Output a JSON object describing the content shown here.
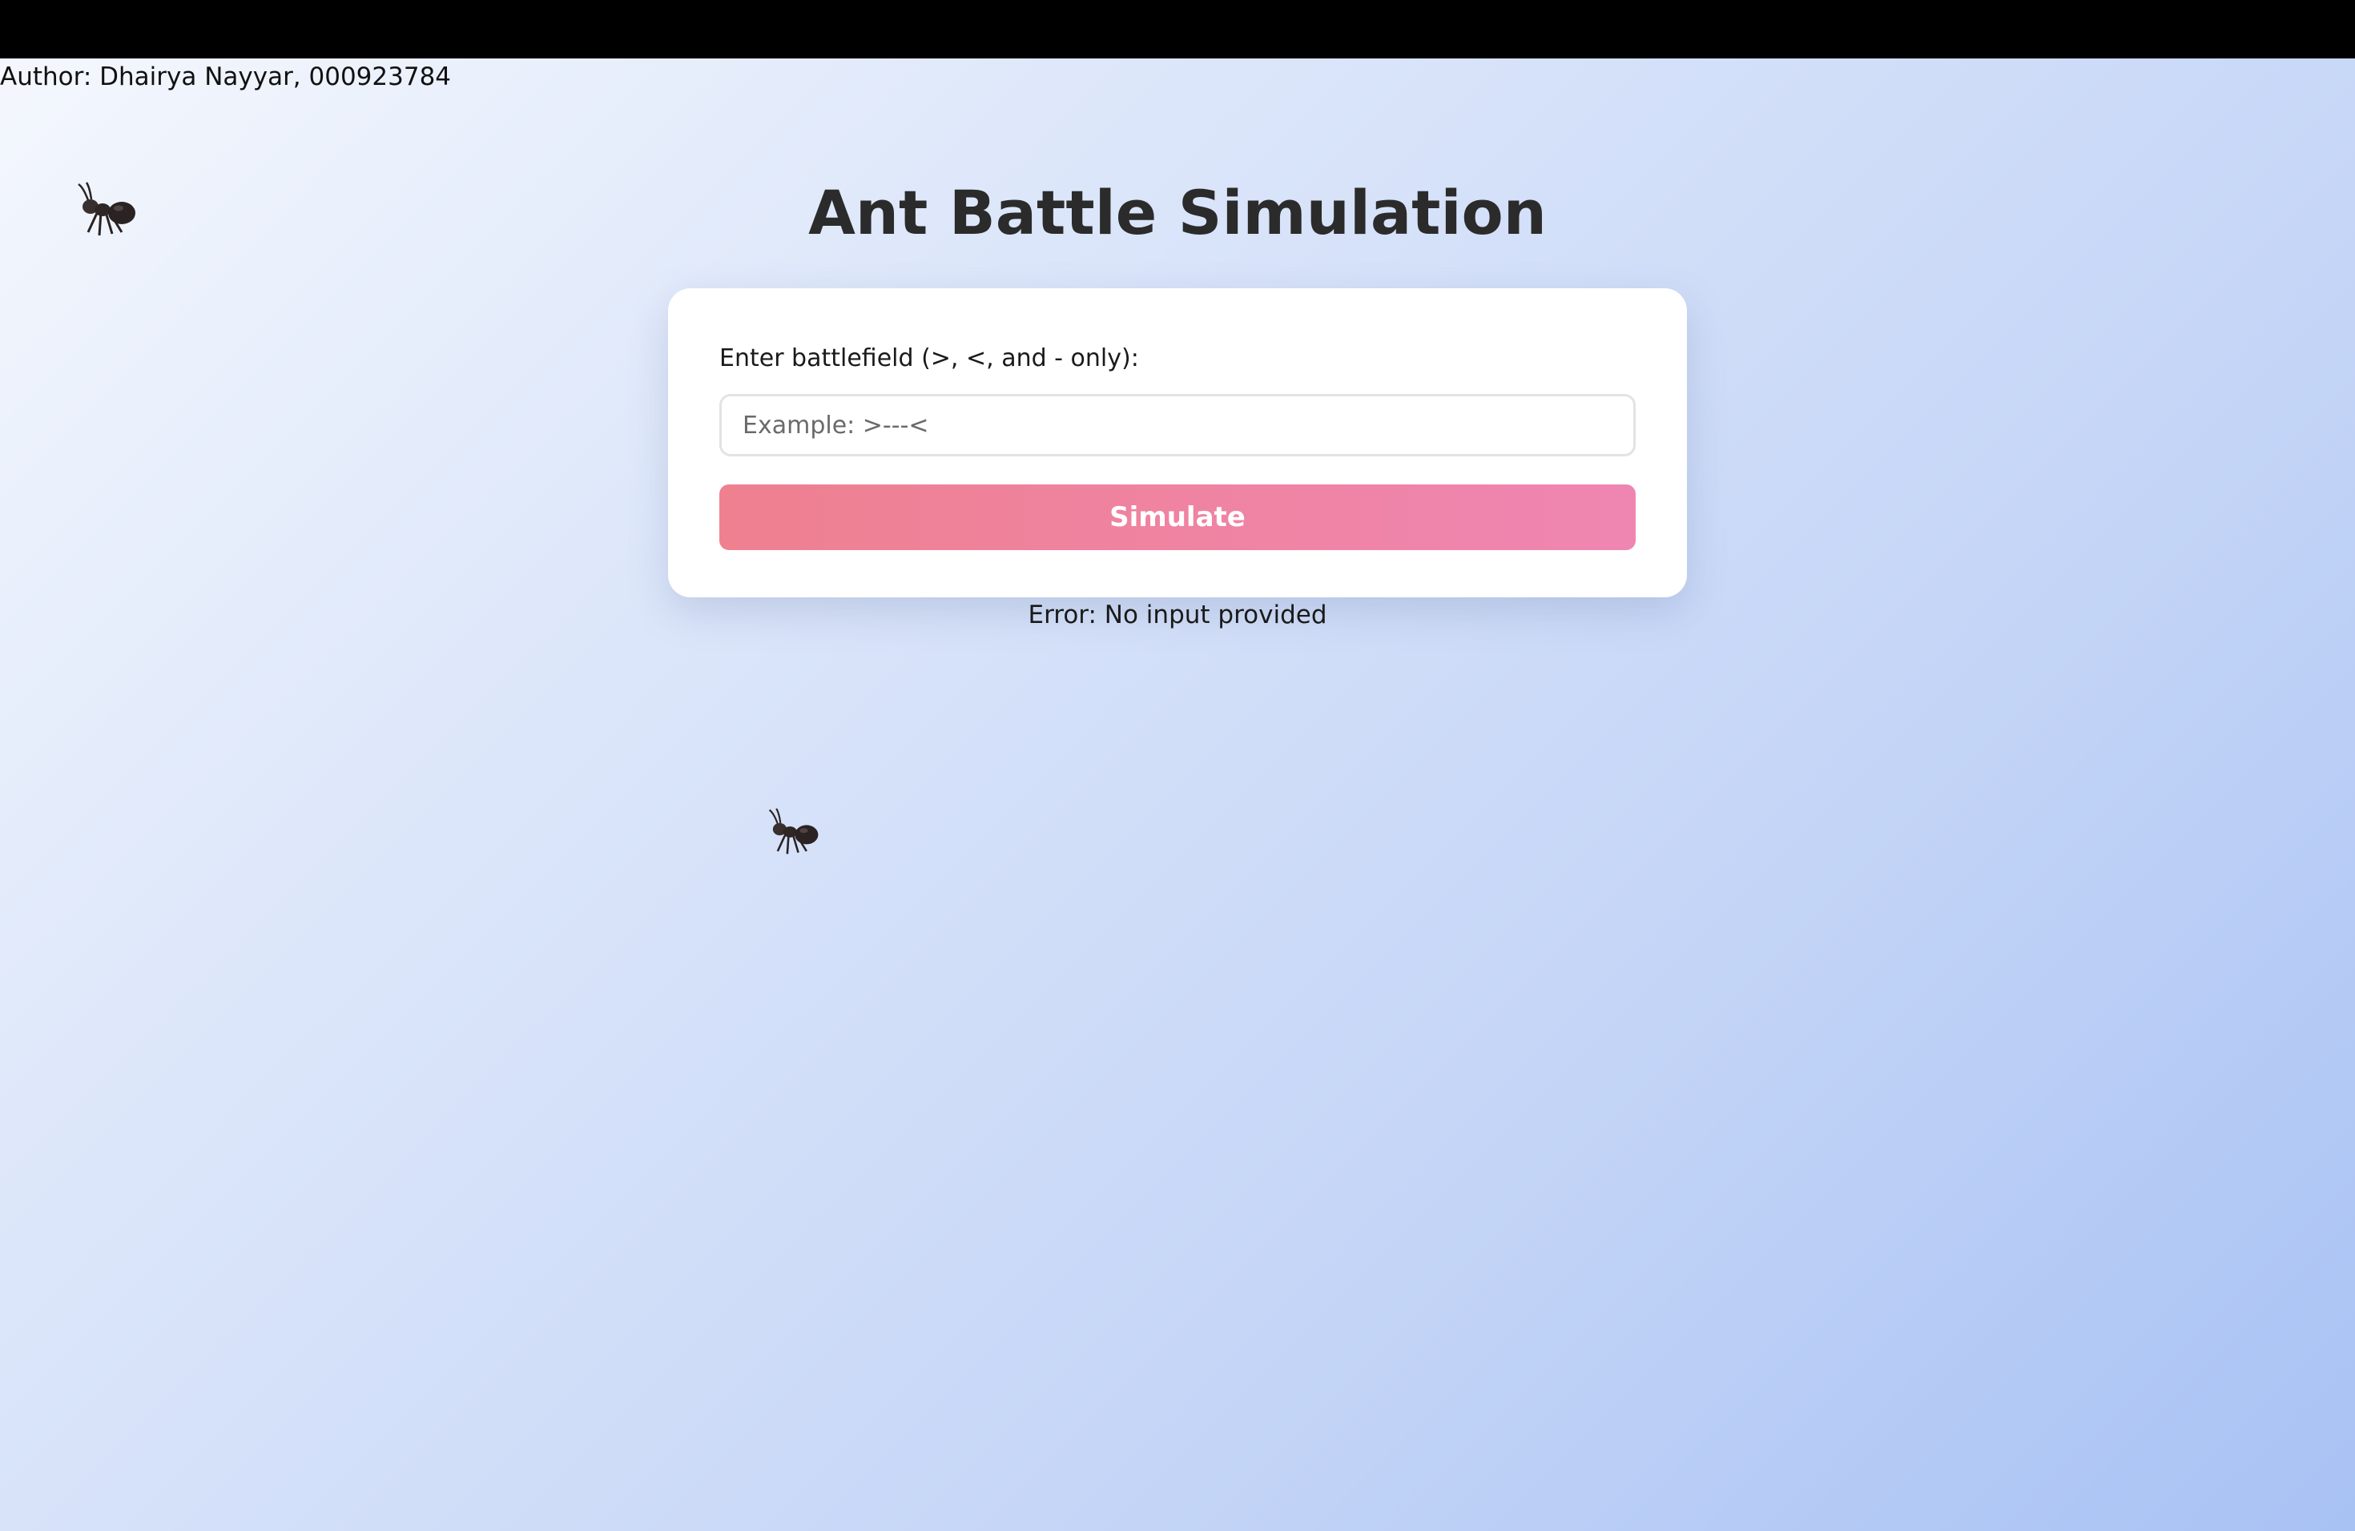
{
  "author": {
    "text": "Author: Dhairya Nayyar, 000923784"
  },
  "header": {
    "title": "Ant Battle Simulation"
  },
  "form": {
    "label": "Enter battlefield (>, <, and - only):",
    "input": {
      "value": "",
      "placeholder": "Example: >---<"
    },
    "submit_label": "Simulate"
  },
  "status": {
    "error": "Error: No input provided"
  },
  "decorations": {
    "icons": [
      "ant-icon",
      "ant-icon"
    ]
  },
  "colors": {
    "button_gradient_start": "#ef8090",
    "button_gradient_end": "#ef86b2",
    "background_start": "#f4f7fd",
    "background_end": "#a8c2f4",
    "title": "#2b2b2b"
  }
}
